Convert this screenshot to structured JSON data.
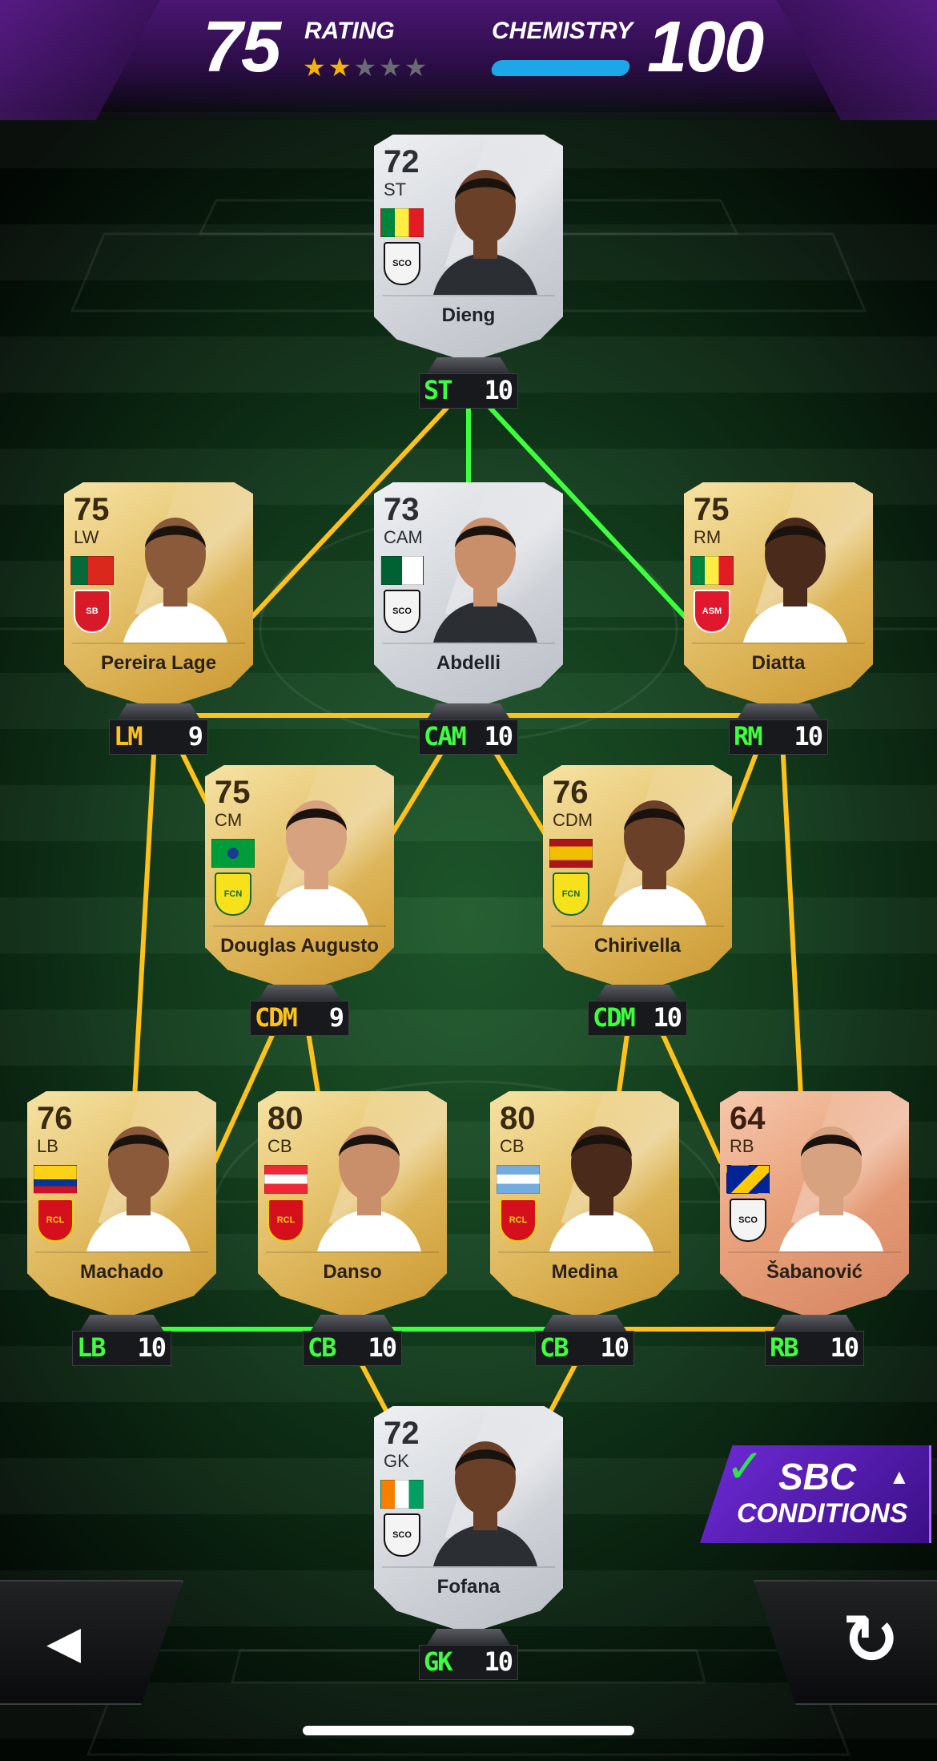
{
  "header": {
    "rating_value": "75",
    "rating_label": "RATING",
    "stars": [
      true,
      true,
      false,
      false,
      false
    ],
    "chemistry_label": "CHEMISTRY",
    "chemistry_value": "100",
    "chemistry_fill": 1.0
  },
  "colors": {
    "link_green": "#3dff3d",
    "link_yellow": "#ffc21a",
    "header_purple": "#4a1672"
  },
  "players": [
    {
      "id": "st",
      "name": "Dieng",
      "rating": "72",
      "pos": "ST",
      "tier": "silver",
      "flag": "senegal",
      "club": "SCO",
      "chem_pos": "ST",
      "chem_val": "10"
    },
    {
      "id": "lm",
      "name": "Pereira Lage",
      "rating": "75",
      "pos": "LW",
      "tier": "gold",
      "flag": "portugal",
      "club": "SB",
      "chem_pos": "LM",
      "chem_val": "9"
    },
    {
      "id": "cam",
      "name": "Abdelli",
      "rating": "73",
      "pos": "CAM",
      "tier": "silver",
      "flag": "algeria",
      "club": "SCO",
      "chem_pos": "CAM",
      "chem_val": "10"
    },
    {
      "id": "rm",
      "name": "Diatta",
      "rating": "75",
      "pos": "RM",
      "tier": "gold",
      "flag": "senegal",
      "club": "ASM",
      "chem_pos": "RM",
      "chem_val": "10"
    },
    {
      "id": "cdm1",
      "name": "Douglas Augusto",
      "rating": "75",
      "pos": "CM",
      "tier": "gold",
      "flag": "brazil",
      "club": "FCN",
      "chem_pos": "CDM",
      "chem_val": "9"
    },
    {
      "id": "cdm2",
      "name": "Chirivella",
      "rating": "76",
      "pos": "CDM",
      "tier": "gold",
      "flag": "spain",
      "club": "FCN",
      "chem_pos": "CDM",
      "chem_val": "10"
    },
    {
      "id": "lb",
      "name": "Machado",
      "rating": "76",
      "pos": "LB",
      "tier": "gold",
      "flag": "colombia",
      "club": "RCL",
      "chem_pos": "LB",
      "chem_val": "10"
    },
    {
      "id": "cb1",
      "name": "Danso",
      "rating": "80",
      "pos": "CB",
      "tier": "gold",
      "flag": "austria",
      "club": "RCL",
      "chem_pos": "CB",
      "chem_val": "10"
    },
    {
      "id": "cb2",
      "name": "Medina",
      "rating": "80",
      "pos": "CB",
      "tier": "gold",
      "flag": "argentina",
      "club": "RCL",
      "chem_pos": "CB",
      "chem_val": "10"
    },
    {
      "id": "rb",
      "name": "Šabanović",
      "rating": "64",
      "pos": "RB",
      "tier": "bronze",
      "flag": "bosnia",
      "club": "SCO",
      "chem_pos": "RB",
      "chem_val": "10"
    },
    {
      "id": "gk",
      "name": "Fofana",
      "rating": "72",
      "pos": "GK",
      "tier": "silver",
      "flag": "ivory-coast",
      "club": "SCO",
      "chem_pos": "GK",
      "chem_val": "10"
    }
  ],
  "sbc": {
    "line1": "SBC",
    "line2": "CONDITIONS"
  },
  "controls": {
    "back_icon": "back-triangle-icon",
    "reset_icon": "reset-arrow-icon"
  }
}
